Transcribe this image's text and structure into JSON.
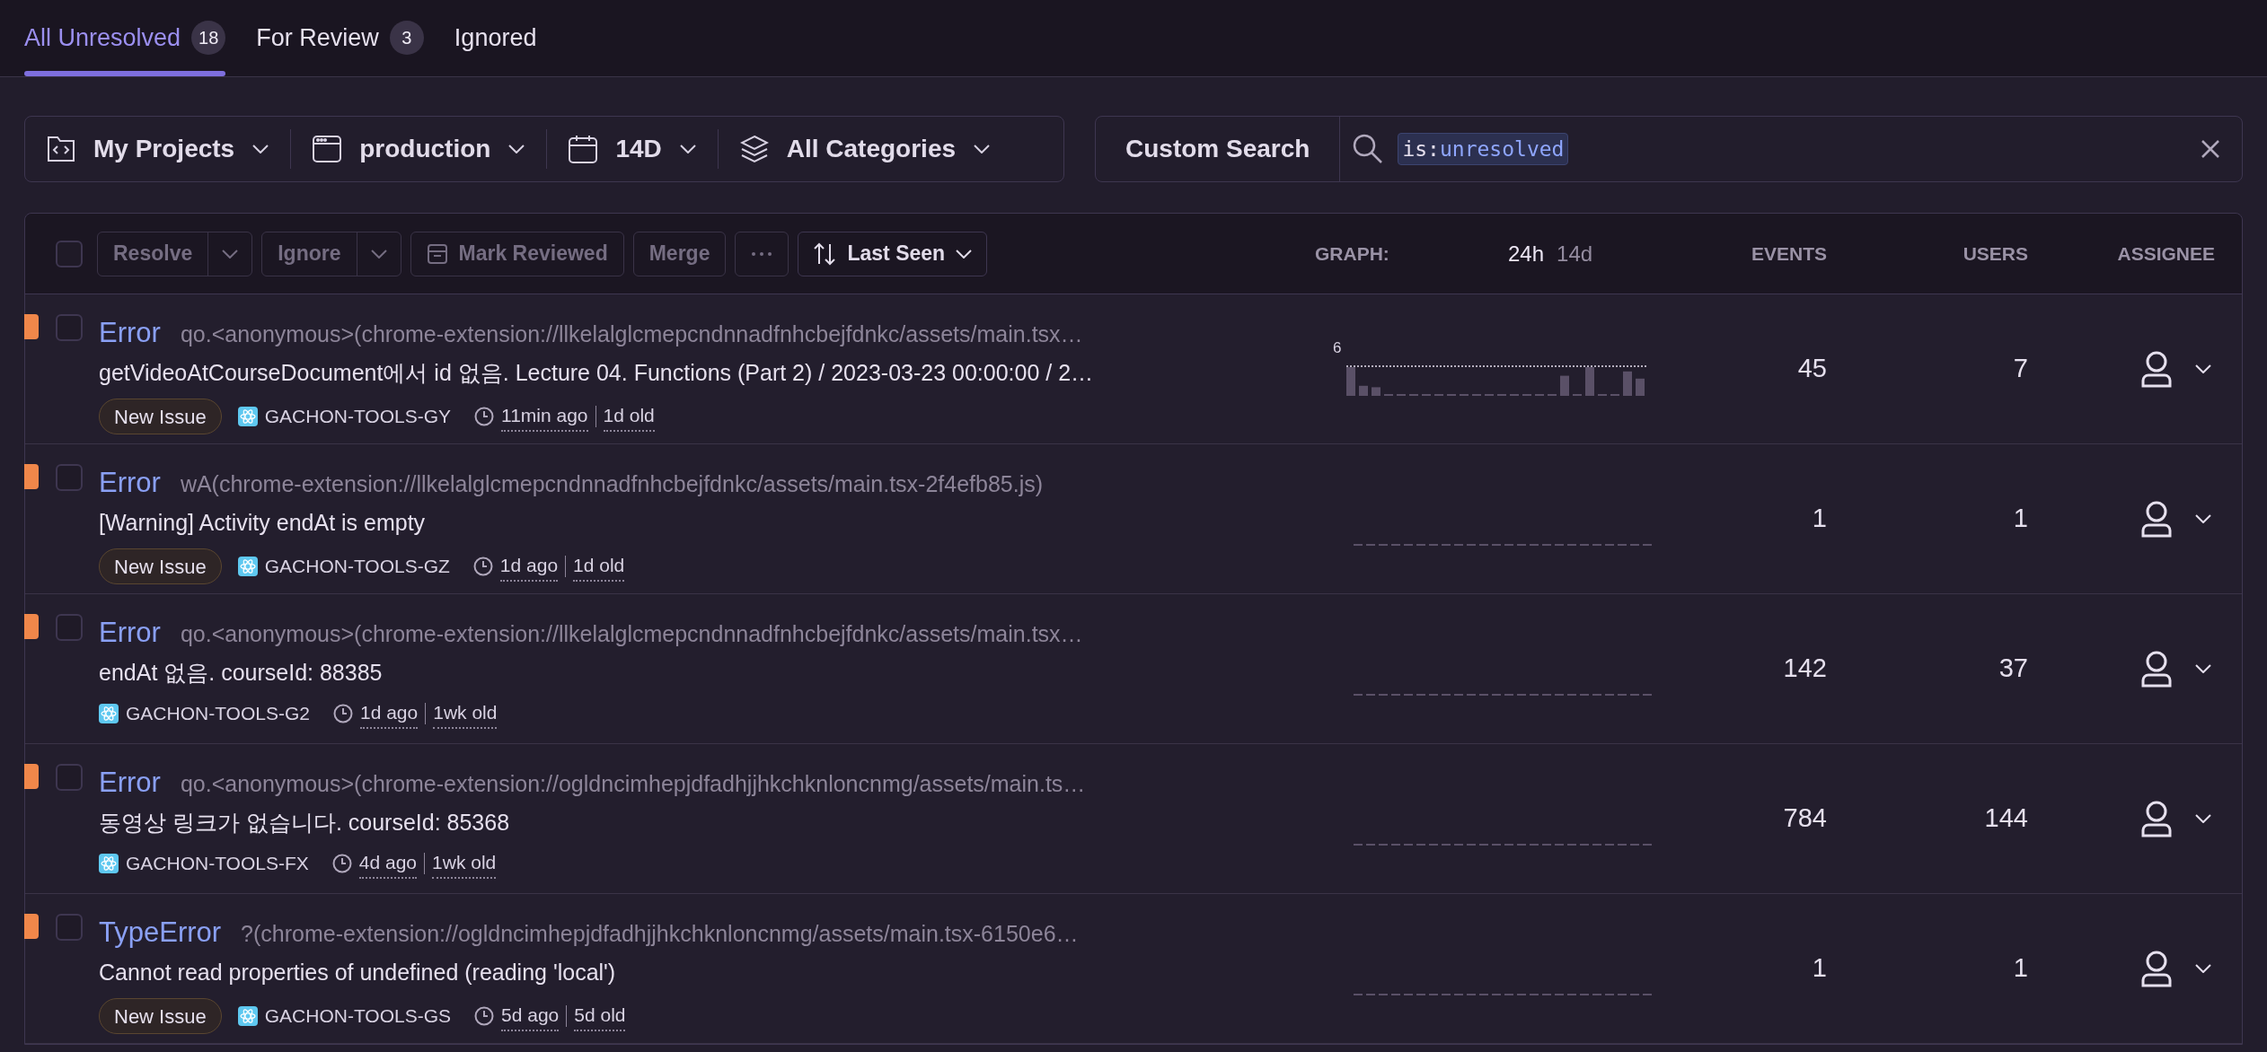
{
  "tabs": [
    {
      "label": "All Unresolved",
      "count": "18",
      "selected": true
    },
    {
      "label": "For Review",
      "count": "3",
      "selected": false
    },
    {
      "label": "Ignored",
      "selected": false
    }
  ],
  "filters": [
    {
      "kind": "project",
      "label": "My Projects"
    },
    {
      "kind": "environment",
      "label": "production"
    },
    {
      "kind": "date",
      "label": "14D"
    },
    {
      "kind": "category",
      "label": "All Categories"
    }
  ],
  "search": {
    "label": "Custom Search",
    "token_key": "is:",
    "token_value": "unresolved"
  },
  "toolbar": {
    "select_all_checked": false,
    "actions": [
      {
        "kind": "split",
        "label": "Resolve"
      },
      {
        "kind": "split",
        "label": "Ignore"
      },
      {
        "kind": "icon",
        "label": "Mark Reviewed"
      },
      {
        "kind": "plain",
        "label": "Merge"
      },
      {
        "kind": "more"
      }
    ],
    "sort": "Last Seen"
  },
  "header": {
    "graph": "GRAPH:",
    "periods": [
      {
        "label": "24h",
        "selected": true
      },
      {
        "label": "14d",
        "selected": false
      }
    ],
    "events": "EVENTS",
    "users": "USERS",
    "assignee": "ASSIGNEE"
  },
  "rows": [
    {
      "checked": false,
      "type": "Error",
      "location": "qo.<anonymous>(chrome-extension://llkelalglcmepcndnnadfnhcbejfdnkc/assets/main.tsx…",
      "message": "getVideoAtCourseDocument에서 id 없음. Lecture 04. Functions (Part 2) / 2023-03-23 00:00:00 / 2…",
      "badge": "New Issue",
      "project": "GACHON-TOOLS-GY",
      "last_seen": "11min ago",
      "age": "1d old",
      "graph_max": "6",
      "events": "45",
      "users": "7"
    },
    {
      "checked": false,
      "type": "Error",
      "location": "wA(chrome-extension://llkelalglcmepcndnnadfnhcbejfdnkc/assets/main.tsx-2f4efb85.js)",
      "message": "[Warning] Activity endAt is empty",
      "badge": "New Issue",
      "project": "GACHON-TOOLS-GZ",
      "last_seen": "1d ago",
      "age": "1d old",
      "events": "1",
      "users": "1"
    },
    {
      "checked": false,
      "type": "Error",
      "location": "qo.<anonymous>(chrome-extension://llkelalglcmepcndnnadfnhcbejfdnkc/assets/main.tsx…",
      "message": "endAt 없음. courseId: 88385",
      "project": "GACHON-TOOLS-G2",
      "last_seen": "1d ago",
      "age": "1wk old",
      "events": "142",
      "users": "37"
    },
    {
      "checked": false,
      "type": "Error",
      "location": "qo.<anonymous>(chrome-extension://ogldncimhepjdfadhjjhkchknloncnmg/assets/main.ts…",
      "message": "동영상 링크가 없습니다. courseId: 85368",
      "project": "GACHON-TOOLS-FX",
      "last_seen": "4d ago",
      "age": "1wk old",
      "events": "784",
      "users": "144"
    },
    {
      "checked": false,
      "type": "TypeError",
      "location": "?(chrome-extension://ogldncimhepjdfadhjjhkchknloncnmg/assets/main.tsx-6150e6…",
      "message": "Cannot read properties of undefined (reading 'local')",
      "badge": "New Issue",
      "project": "GACHON-TOOLS-GS",
      "last_seen": "5d ago",
      "age": "5d old",
      "events": "1",
      "users": "1"
    }
  ]
}
